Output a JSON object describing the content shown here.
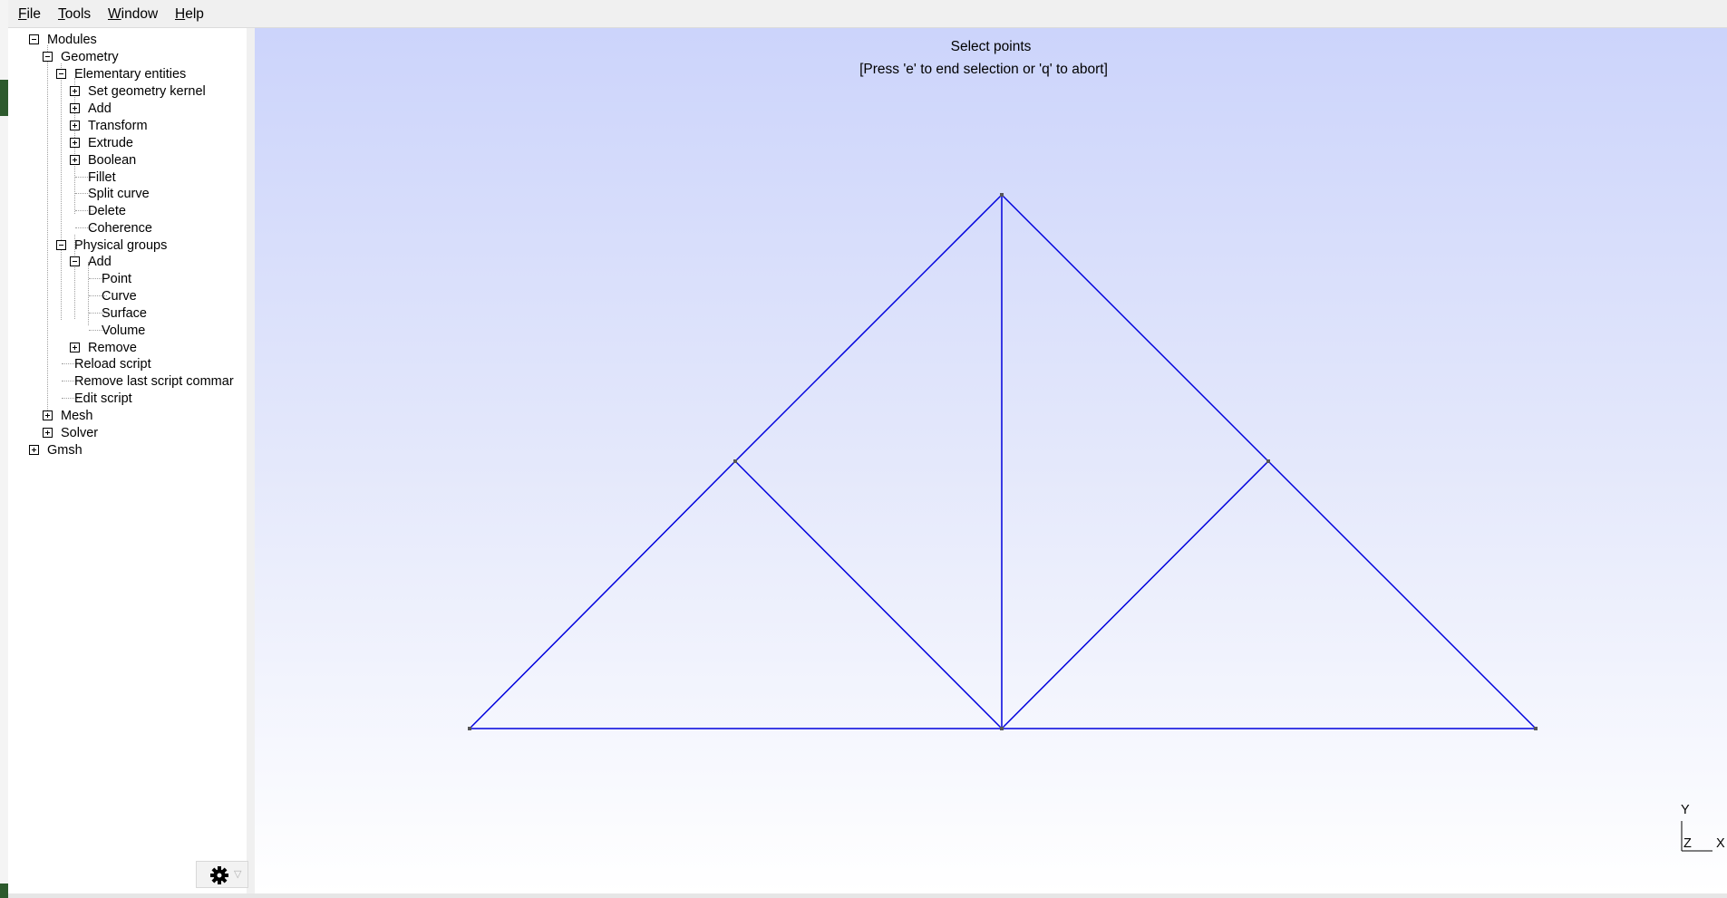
{
  "menu": [
    {
      "label": "File",
      "mnemonic": "F",
      "rest": "ile"
    },
    {
      "label": "Tools",
      "mnemonic": "T",
      "rest": "ools"
    },
    {
      "label": "Window",
      "mnemonic": "W",
      "rest": "indow"
    },
    {
      "label": "Help",
      "mnemonic": "H",
      "rest": "elp"
    }
  ],
  "tree": {
    "modules": "Modules",
    "geometry": "Geometry",
    "elementary_entities": "Elementary entities",
    "set_geometry_kernel": "Set geometry kernel",
    "add": "Add",
    "transform": "Transform",
    "extrude": "Extrude",
    "boolean": "Boolean",
    "fillet": "Fillet",
    "split_curve": "Split curve",
    "delete": "Delete",
    "coherence": "Coherence",
    "physical_groups": "Physical groups",
    "pg_add": "Add",
    "point": "Point",
    "curve": "Curve",
    "surface": "Surface",
    "volume": "Volume",
    "remove": "Remove",
    "reload_script": "Reload script",
    "remove_last_script_command": "Remove last script commar",
    "edit_script": "Edit script",
    "mesh": "Mesh",
    "solver": "Solver",
    "gmsh": "Gmsh"
  },
  "viewport": {
    "message_line1": "Select points",
    "message_line2": "[Press 'e' to end selection or 'q' to abort]",
    "line_color": "#0000dd",
    "point_color": "#555555"
  },
  "axes": {
    "y": "Y",
    "z": "Z",
    "x": "X"
  }
}
